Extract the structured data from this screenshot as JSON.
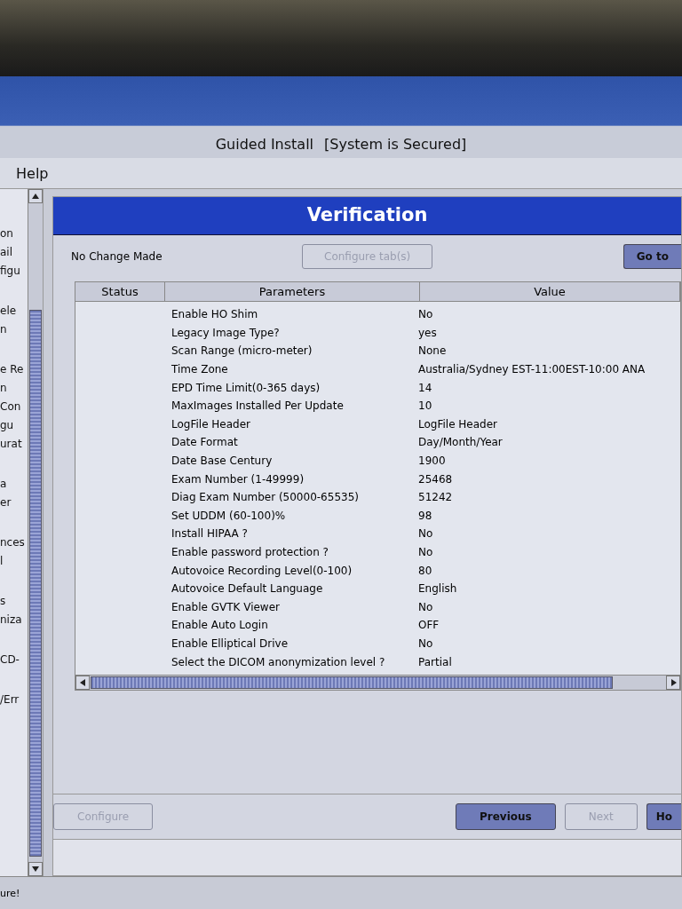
{
  "window": {
    "title": "Guided Install",
    "security": "[System is Secured]"
  },
  "menu": [
    "Help"
  ],
  "sidebar": {
    "groups": [
      [
        "on",
        "ail",
        "figu"
      ],
      [
        "ele",
        "n"
      ],
      [
        "e Re",
        "n",
        "Con",
        "gu",
        "urat"
      ],
      [
        "a",
        "er"
      ],
      [
        "nces",
        "l"
      ],
      [
        "s",
        "niza"
      ],
      [
        "CD-"
      ],
      [
        "/Err"
      ]
    ]
  },
  "panel": {
    "title": "Verification",
    "message": "No Change Made",
    "top_buttons": [
      {
        "label": "Configure tab(s)",
        "disabled": true
      },
      {
        "label": "Go to",
        "disabled": false
      }
    ],
    "table": {
      "columns": [
        "Status",
        "Parameters",
        "Value"
      ],
      "rows": [
        {
          "parameter": "Enable HO Shim",
          "value": "No"
        },
        {
          "parameter": "Legacy Image Type?",
          "value": "yes"
        },
        {
          "parameter": "Scan Range (micro-meter)",
          "value": "None"
        },
        {
          "parameter": "Time Zone",
          "value": "Australia/Sydney EST-11:00EST-10:00 ANA"
        },
        {
          "parameter": "EPD Time Limit(0-365 days)",
          "value": "14"
        },
        {
          "parameter": "MaxImages Installed Per Update",
          "value": "10"
        },
        {
          "parameter": "LogFile Header",
          "value": "LogFile Header"
        },
        {
          "parameter": "Date Format",
          "value": "Day/Month/Year"
        },
        {
          "parameter": "Date Base Century",
          "value": "1900"
        },
        {
          "parameter": "Exam Number (1-49999)",
          "value": "25468"
        },
        {
          "parameter": "Diag Exam Number (50000-65535)",
          "value": "51242"
        },
        {
          "parameter": "Set UDDM (60-100)%",
          "value": "98"
        },
        {
          "parameter": "Install HIPAA ?",
          "value": "No"
        },
        {
          "parameter": "Enable password protection ?",
          "value": "No"
        },
        {
          "parameter": "Autovoice Recording Level(0-100)",
          "value": "80"
        },
        {
          "parameter": "Autovoice Default Language",
          "value": "English"
        },
        {
          "parameter": "Enable GVTK Viewer",
          "value": "No"
        },
        {
          "parameter": "Enable Auto Login",
          "value": "OFF"
        },
        {
          "parameter": "Enable Elliptical Drive",
          "value": "No"
        },
        {
          "parameter": "Select the DICOM anonymization level ?",
          "value": "Partial"
        }
      ]
    },
    "bottom_buttons": [
      {
        "label": "Configure",
        "disabled": true,
        "kind": "left"
      },
      {
        "label": "Previous",
        "disabled": false,
        "kind": "right"
      },
      {
        "label": "Next",
        "disabled": true,
        "kind": "right"
      },
      {
        "label": "Ho",
        "disabled": false,
        "kind": "right"
      }
    ]
  },
  "status_bar": "ure!"
}
